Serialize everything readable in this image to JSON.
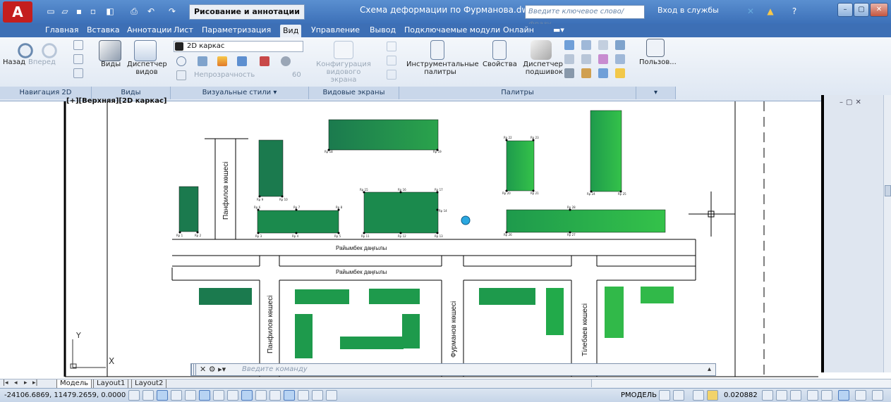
{
  "titlebar": {
    "workspace": "Рисование и аннотации",
    "document_title": "Схема деформации по Фурманова.dwg",
    "search_placeholder": "Введите ключевое слово/фразу",
    "signin": "Вход в службы"
  },
  "menu_tabs": [
    "Главная",
    "Вставка",
    "Аннотации",
    "Лист",
    "Параметризация",
    "Вид",
    "Управление",
    "Вывод",
    "Подключаемые модули",
    "Онлайн"
  ],
  "active_tab": "Вид",
  "ribbon": {
    "nav_back": "Назад",
    "nav_forward": "Вперед",
    "views": "Виды",
    "view_manager": "Диспетчер видов",
    "visual_style": "2D каркас",
    "opacity": "Непрозрачность",
    "opacity_value": "60",
    "viewport_config": "Конфигурация видового экрана",
    "tool_palettes": "Инструментальные палитры",
    "properties": "Свойства",
    "sheet_set_manager": "Диспетчер подшивок",
    "user_interface": "Пользов...",
    "groups": {
      "nav2d": "Навигация 2D",
      "views": "Виды",
      "visual_styles": "Визуальные стили",
      "model_viewports": "Видовые экраны модели",
      "palettes": "Палитры"
    }
  },
  "viewport": {
    "label": "[+][Верхняя][2D каркас]"
  },
  "map": {
    "streets": {
      "main_top": "Райымбек даңғылы",
      "main_bottom": "Райымбек даңғылы",
      "panfilov_top": "Панфилов көшесі",
      "panfilov_bottom": "Панфилов көшесі",
      "furmanov": "Фурманов көшесі",
      "tlebaev": "Тілебаев көшесі"
    },
    "point_labels": [
      "Rp 1",
      "Rp 2",
      "Rp 3",
      "Rp 4",
      "Rp 5",
      "Rp 6",
      "Rp 7",
      "Rp 8",
      "Rp 9",
      "Rp 10",
      "Rp 11",
      "Rp 12",
      "Rp 13",
      "Rp 14",
      "Rp 15",
      "Rp 16",
      "Rp 17",
      "Rp 18",
      "Rp 19",
      "Rp 20",
      "Rp 21",
      "Rp 22",
      "Rp 23",
      "Rp 24",
      "Rp 25",
      "Rp 26",
      "Rp 27",
      "Rp 28"
    ],
    "ucs_y": "Y",
    "ucs_x": "X"
  },
  "command_line": {
    "placeholder": "Введите команду"
  },
  "layout_tabs": [
    "Модель",
    "Layout1",
    "Layout2"
  ],
  "status": {
    "coords": "-24106.6869, 11479.2659, 0.0000",
    "model": "РМОДЕЛЬ",
    "scale": "0.020882"
  },
  "colors": {
    "building_dark": "#1b7a4e",
    "building_mid": "#1e9a4c",
    "building_light": "#31b949",
    "accent_title": "#3c70b8"
  }
}
